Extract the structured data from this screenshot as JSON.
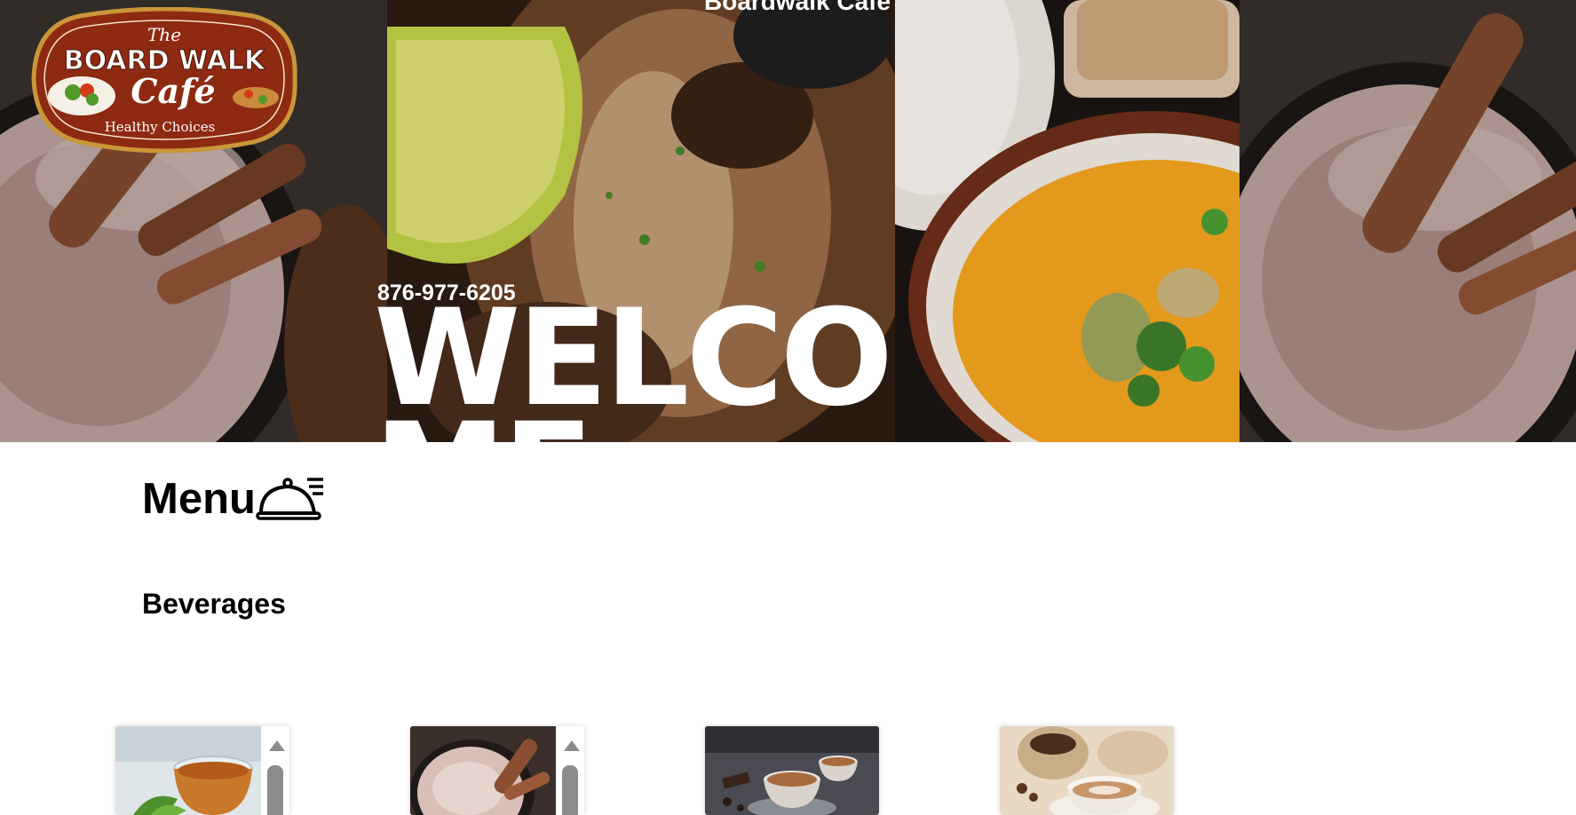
{
  "site": {
    "title": "Boardwalk Cafe",
    "phone": "876-977-6205",
    "welcome": "WELCOME"
  },
  "logo": {
    "the": "The",
    "board_walk": "BOARD WALK",
    "cafe": "Café",
    "tagline": "Healthy Choices"
  },
  "menu": {
    "title": "Menu",
    "icon": "food-cloche-icon",
    "sections": [
      {
        "title": "Beverages"
      }
    ],
    "cards": [
      {
        "image": "herbal-tea-image",
        "scrollbar": true
      },
      {
        "image": "hot-chocolate-image",
        "scrollbar": true
      },
      {
        "image": "cappuccino-cups-image",
        "scrollbar": false
      },
      {
        "image": "latte-coffee-beans-image",
        "scrollbar": false
      }
    ]
  },
  "colors": {
    "logo_red": "#8e2a12",
    "logo_border": "#c9963a",
    "hero_dark": "#2a2220"
  }
}
